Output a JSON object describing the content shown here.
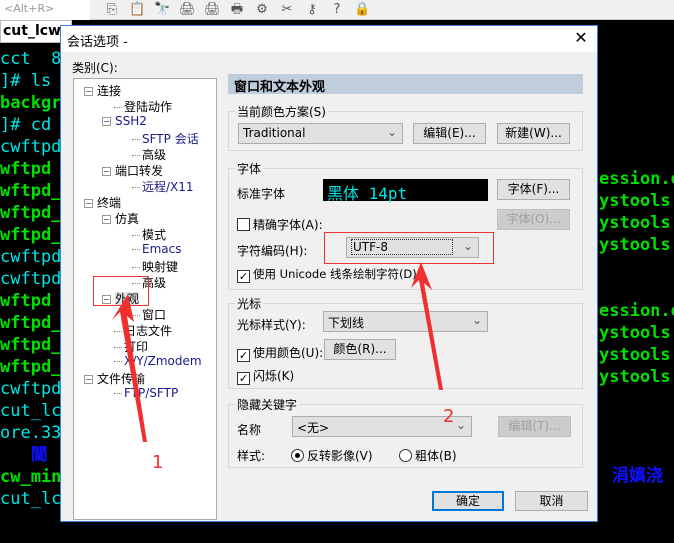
{
  "toolbar": {
    "quick_connect_placeholder": "<Alt+R>",
    "icons": [
      "copy-icon",
      "paste-icon",
      "find-icon",
      "print-icon",
      "print-setup-icon",
      "print-screen-icon",
      "session-options-icon",
      "keymap-icon",
      "key-icon",
      "help-icon",
      "lock-icon"
    ]
  },
  "tab": {
    "label": "cut_lcw",
    "close": "×"
  },
  "terminal_left": [
    {
      "t": "cct  8",
      "c": "cy"
    },
    {
      "t": "]# ls",
      "c": "cy"
    },
    {
      "t": "backgr",
      "c": "gr"
    },
    {
      "t": "]# cd",
      "c": "cy"
    },
    {
      "t": "cwftpd",
      "c": "cy"
    },
    {
      "t": "wftpd",
      "c": "gr"
    },
    {
      "t": "wftpd_h",
      "c": "gr"
    },
    {
      "t": "wftpd_l",
      "c": "gr"
    },
    {
      "t": "wftpd_l",
      "c": "gr"
    },
    {
      "t": "cwftpd",
      "c": "cy"
    },
    {
      "t": "cwftpd",
      "c": "cy"
    },
    {
      "t": "wftpd",
      "c": "gr"
    },
    {
      "t": "wftpd_h",
      "c": "gr"
    },
    {
      "t": "wftpd_l",
      "c": "gr"
    },
    {
      "t": "wftpd_l",
      "c": "gr"
    },
    {
      "t": "cwftpd",
      "c": "cy"
    },
    {
      "t": "cut_lc",
      "c": "cy"
    },
    {
      "t": "ore.33",
      "c": "cy"
    },
    {
      "t": "   閫",
      "c": "bl"
    },
    {
      "t": "cw_min",
      "c": "gr"
    },
    {
      "t": "cut_lc",
      "c": "cy"
    }
  ],
  "terminal_right": [
    {
      "t": "ession.o",
      "row": 5
    },
    {
      "t": "ystools.c",
      "row": 6
    },
    {
      "t": "ystools.h",
      "row": 7
    },
    {
      "t": "ystools.c",
      "row": 8
    },
    {
      "t": "ession.o",
      "row": 11
    },
    {
      "t": "ystools.c",
      "row": 12
    },
    {
      "t": "ystools.h",
      "row": 13
    },
    {
      "t": "ystools.c",
      "row": 14
    }
  ],
  "terminal_right_blue": "涓嫃浇",
  "dialog": {
    "title": "会话选项 -",
    "close": "✕",
    "category_label": "类别(C):",
    "tree": [
      {
        "label": "连接",
        "lvl": 0,
        "pm": true
      },
      {
        "label": "登陆动作",
        "lvl": 1
      },
      {
        "label": "SSH2",
        "lvl": 1,
        "pm": true,
        "sm": true
      },
      {
        "label": "SFTP 会话",
        "lvl": 2,
        "sm": true
      },
      {
        "label": "高级",
        "lvl": 2
      },
      {
        "label": "端口转发",
        "lvl": 1,
        "pm": true
      },
      {
        "label": "远程/X11",
        "lvl": 2,
        "sm": true
      },
      {
        "label": "终端",
        "lvl": 0,
        "pm": true
      },
      {
        "label": "仿真",
        "lvl": 1,
        "pm": true
      },
      {
        "label": "模式",
        "lvl": 2
      },
      {
        "label": "Emacs",
        "lvl": 2,
        "sm": true
      },
      {
        "label": "映射键",
        "lvl": 2
      },
      {
        "label": "高级",
        "lvl": 2
      },
      {
        "label": "外观",
        "lvl": 1,
        "pm": true,
        "selected": true
      },
      {
        "label": "窗口",
        "lvl": 2
      },
      {
        "label": "日志文件",
        "lvl": 1
      },
      {
        "label": "打印",
        "lvl": 1
      },
      {
        "label": "X/Y/Zmodem",
        "lvl": 1,
        "sm": true
      },
      {
        "label": "文件传输",
        "lvl": 0,
        "pm": true
      },
      {
        "label": "FTP/SFTP",
        "lvl": 1,
        "sm": true
      }
    ],
    "header": "窗口和文本外观",
    "color_scheme": {
      "group": "当前颜色方案(S)",
      "value": "Traditional",
      "edit": "编辑(E)...",
      "new": "新建(W)..."
    },
    "font": {
      "group": "字体",
      "standard_label": "标准字体",
      "preview": "黑体 14pt",
      "font_btn": "字体(F)...",
      "precise_label": "精确字体(A):",
      "precise_checked": false,
      "precise_btn": "字体(O)...",
      "encoding_label": "字符编码(H):",
      "encoding_value": "UTF-8",
      "unicode_label": "使用 Unicode 线条绘制字符(D)",
      "unicode_checked": true
    },
    "cursor": {
      "group": "光标",
      "style_label": "光标样式(Y):",
      "style_value": "下划线",
      "use_color_label": "使用颜色(U):",
      "use_color_checked": true,
      "color_btn": "颜色(R)...",
      "blink_label": "闪烁(K)",
      "blink_checked": true
    },
    "keywords": {
      "group": "隐藏关键字",
      "name_label": "名称",
      "name_value": "<无>",
      "edit_btn": "编辑(T)...",
      "style_label": "样式:",
      "opt_reverse": "反转影像(V)",
      "opt_bold": "粗体(B)",
      "selected": "reverse"
    },
    "ok": "确定",
    "cancel": "取消"
  },
  "annotations": {
    "one": "1",
    "two": "2",
    "color": "#f03030"
  }
}
